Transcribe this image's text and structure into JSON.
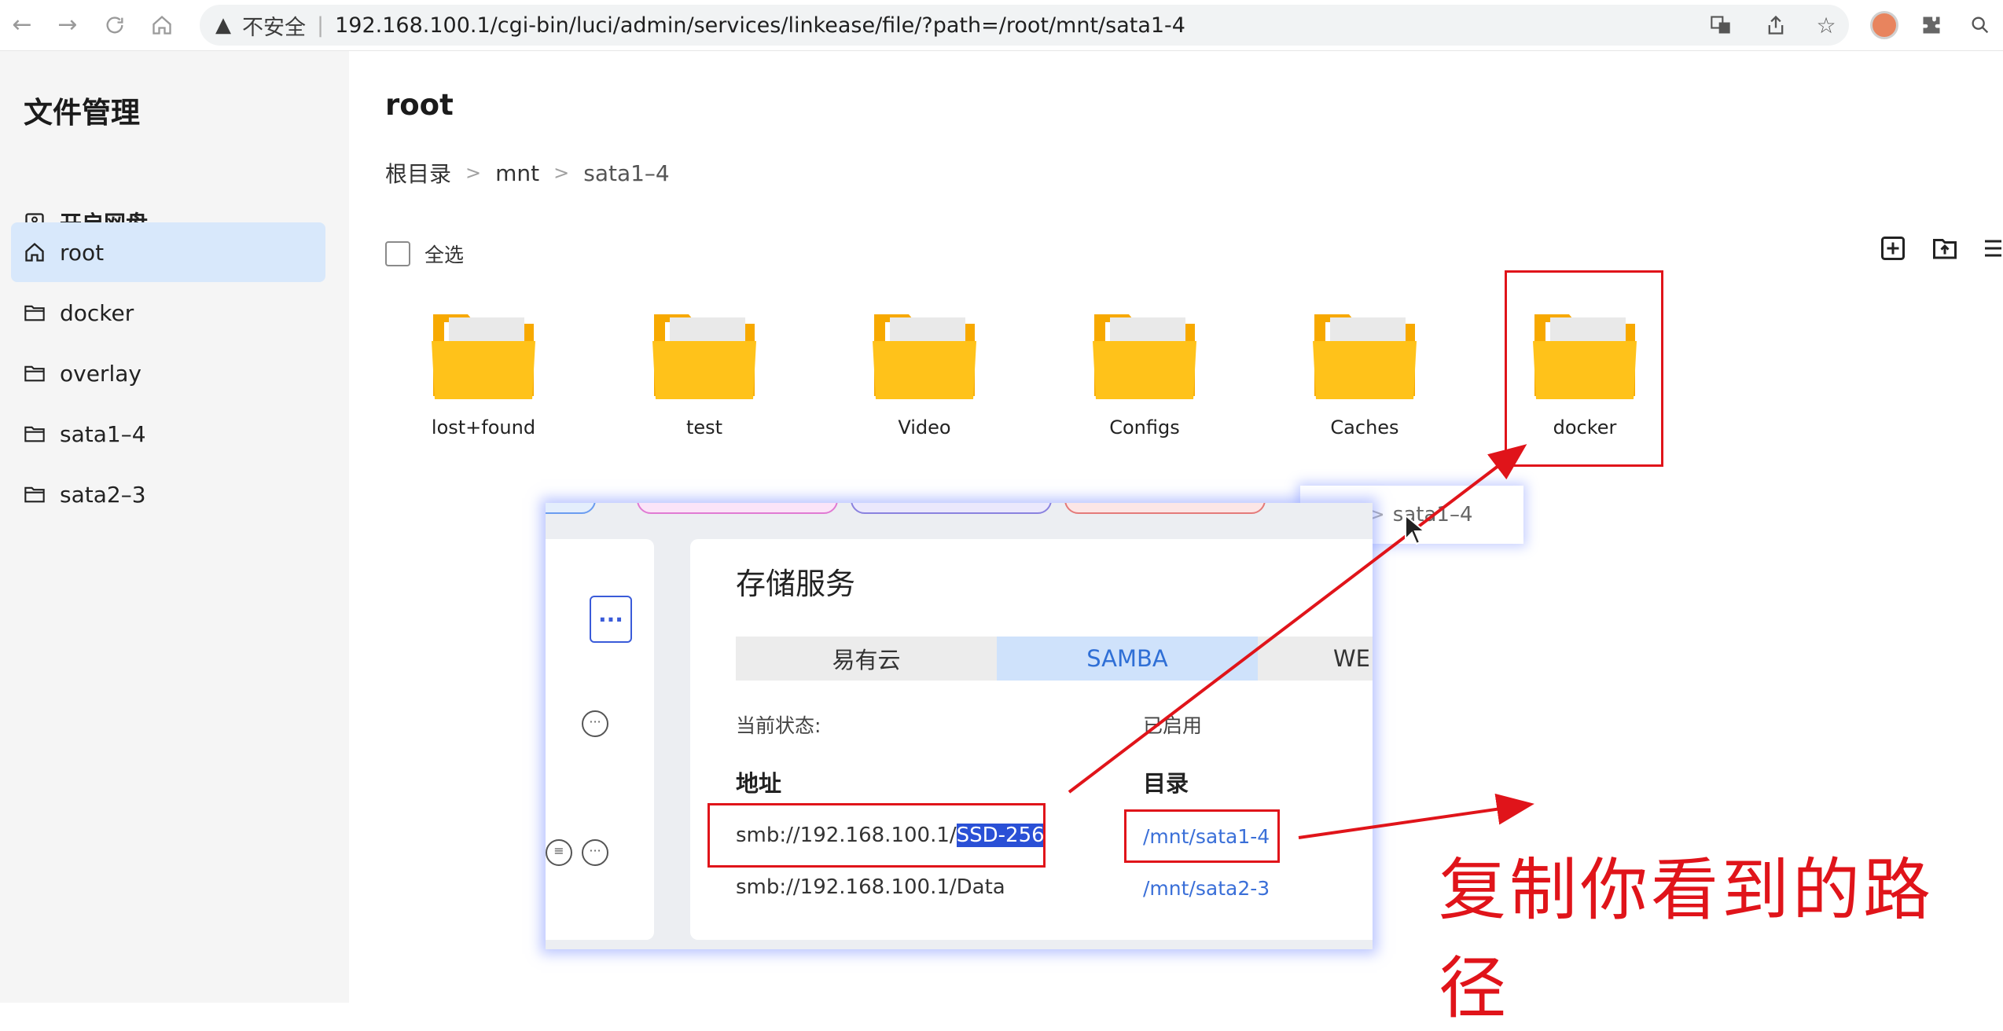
{
  "browser": {
    "insecure_label": "不安全",
    "url": "192.168.100.1/cgi-bin/luci/admin/services/linkease/file/?path=/root/mnt/sata1-4"
  },
  "sidebar": {
    "title": "文件管理",
    "items": [
      {
        "label": "开启网盘",
        "icon": "drive-icon"
      },
      {
        "label": "root",
        "icon": "home-icon"
      },
      {
        "label": "docker",
        "icon": "folder-icon"
      },
      {
        "label": "overlay",
        "icon": "folder-icon"
      },
      {
        "label": "sata1–4",
        "icon": "folder-icon"
      },
      {
        "label": "sata2–3",
        "icon": "folder-icon"
      }
    ]
  },
  "main": {
    "title": "root",
    "breadcrumb": [
      "根目录",
      "mnt",
      "sata1–4"
    ],
    "select_all": "全选",
    "folders": [
      "lost+found",
      "test",
      "Video",
      "Configs",
      "Caches",
      "docker"
    ]
  },
  "overlay": {
    "card_title": "存储服务",
    "tabs": [
      "易有云",
      "SAMBA",
      "WE"
    ],
    "status_label": "当前状态:",
    "status_value": "已启用",
    "address_header": "地址",
    "dir_header": "目录",
    "rows": [
      {
        "addr_prefix": "smb://192.168.100.1/",
        "addr_selected": "SSD-256",
        "dir": "/mnt/sata1-4"
      },
      {
        "addr_prefix": "smb://192.168.100.1/Data",
        "addr_selected": "",
        "dir": "/mnt/sata2-3"
      }
    ],
    "crumb_popup": "sata1–4"
  },
  "annotation": {
    "text": "复制你看到的路径",
    "color": "#e0141a"
  },
  "colors": {
    "folder": "#ffc21a",
    "active_bg": "#d8e8fb",
    "link": "#3a6fd8",
    "selection": "#2a50d6"
  }
}
